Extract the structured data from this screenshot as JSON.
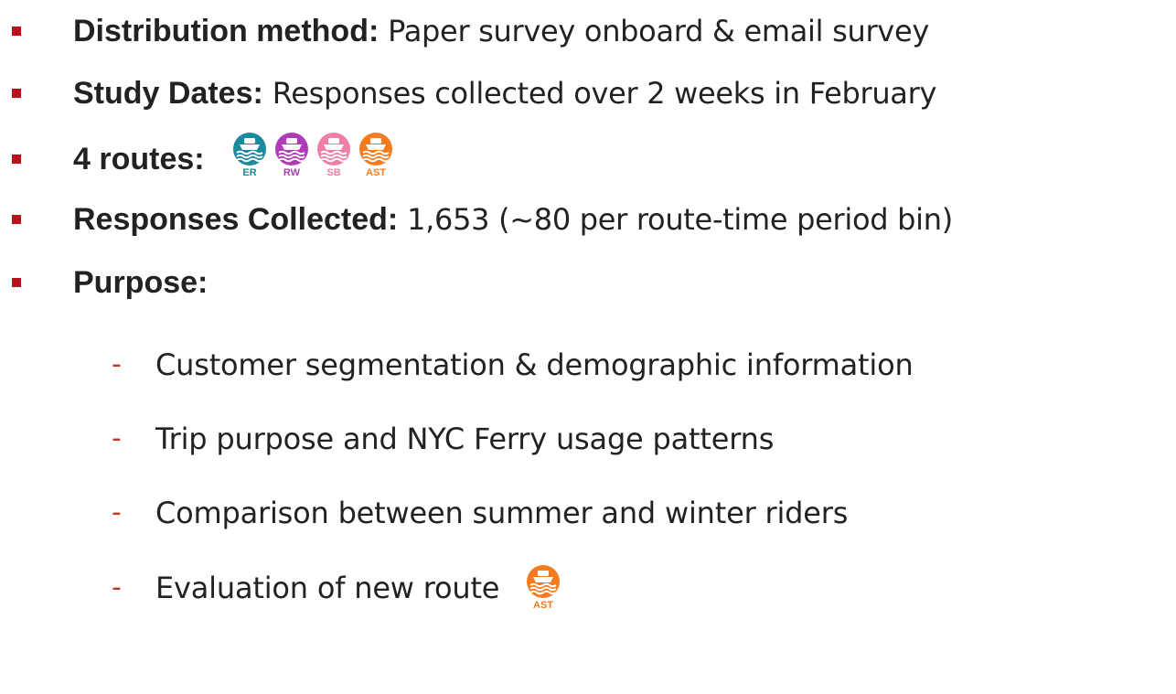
{
  "items": [
    {
      "label": "Distribution method:",
      "text": "Paper survey onboard & email survey"
    },
    {
      "label": "Study Dates:",
      "text": "Responses collected over 2 weeks in February"
    },
    {
      "label": "4 routes:",
      "text": ""
    },
    {
      "label": "Responses Collected:",
      "text": "1,653 (~80 per route-time period bin)"
    },
    {
      "label": "Purpose:",
      "text": ""
    }
  ],
  "routes": [
    {
      "code": "ER",
      "color": "#1a8a9c"
    },
    {
      "code": "RW",
      "color": "#b03bb8"
    },
    {
      "code": "SB",
      "color": "#f07fa8"
    },
    {
      "code": "AST",
      "color": "#f47b20"
    }
  ],
  "purposes": [
    "Customer segmentation & demographic information",
    "Trip purpose and NYC Ferry usage patterns",
    "Comparison between summer and winter riders",
    "Evaluation of new route"
  ],
  "new_route": {
    "code": "AST",
    "color": "#f47b20"
  },
  "colors": {
    "bullet": "#b5121b",
    "dash": "#c0392b",
    "text": "#222222"
  }
}
